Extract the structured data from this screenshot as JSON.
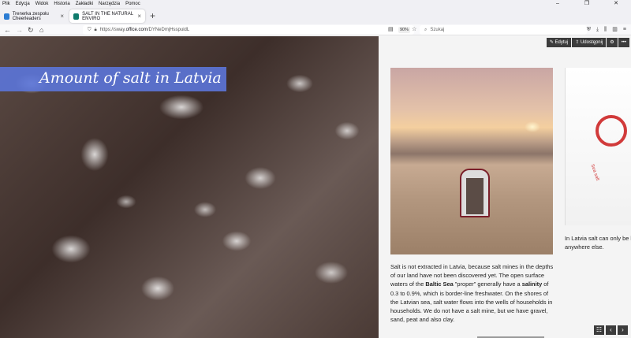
{
  "menubar": {
    "items": [
      "Plik",
      "Edycja",
      "Widok",
      "Historia",
      "Zakładki",
      "Narzędzia",
      "Pomoc"
    ]
  },
  "window_controls": {
    "minimize": "–",
    "restore": "❐",
    "close": "✕"
  },
  "tabs": [
    {
      "label": "Trenerka zespołu Cheerleaders",
      "favicon_color": "#2b7cd3"
    },
    {
      "label": "SALT IN THE NATURAL ENVIRO",
      "favicon_color": "#0f7b6c"
    }
  ],
  "newtab_label": "+",
  "nav": {
    "url_prefix": "https://sway.",
    "url_host": "office.com",
    "url_path": "/DYNeDmjHsspuidL",
    "zoom": "90%",
    "search_placeholder": "Szukaj"
  },
  "sway_toolbar": {
    "edit_label": "Edytuj",
    "share_label": "Udostępnij"
  },
  "hero": {
    "title": "Amount of salt in Latvia"
  },
  "panel": {
    "text_parts": {
      "p1": "Salt is not extracted in Latvia, because salt mines in the depths of our land have not been discovered yet. The open surface waters of the ",
      "b1": "Baltic Sea",
      "p2": " \"proper\" generally have a ",
      "b2": "salinity",
      "p3": " of 0.3 to 0.9%, which is border-line freshwater. On the shores of the Latvian sea, salt water flows into the wells of households in households. We do not have a salt mine, but we have gravel, sand, peat and also clay."
    },
    "side_text_line1": "In Latvia  salt can only be b",
    "side_text_line2": "anywhere else.",
    "bag_brand": "Sea salt"
  }
}
